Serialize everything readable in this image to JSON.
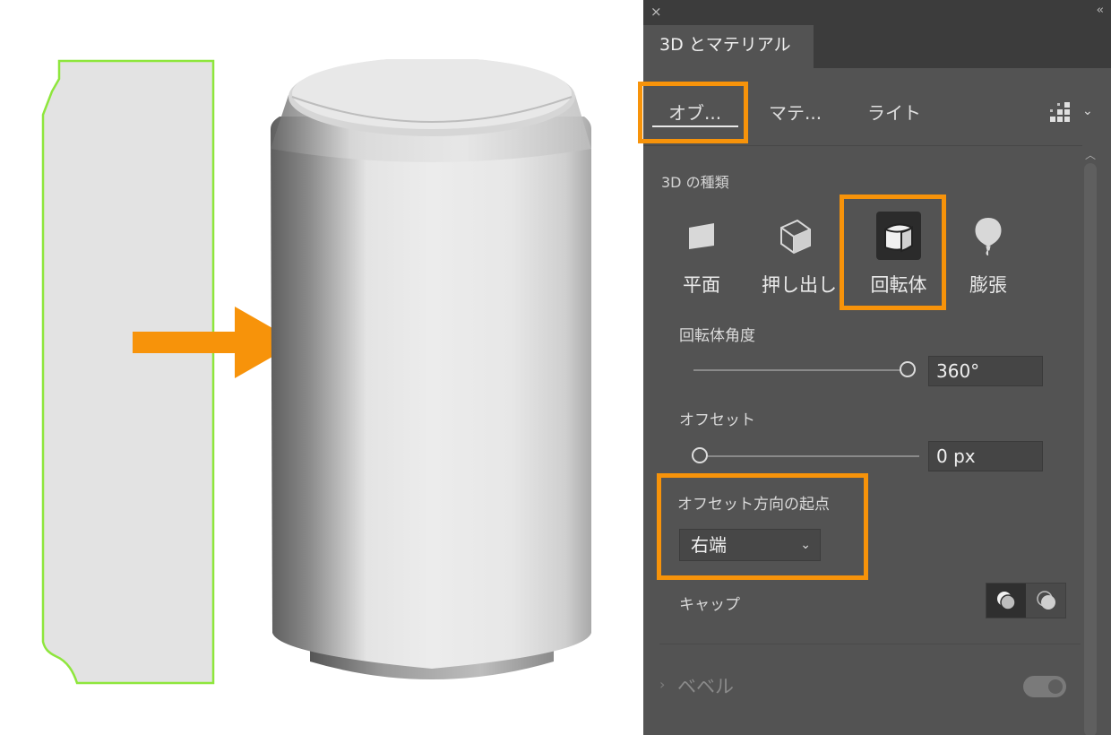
{
  "panel": {
    "title": "3D とマテリアル",
    "close_glyph": "×",
    "collapse_glyph": "‹‹",
    "subtabs": {
      "object": "オブ...",
      "material": "マテ...",
      "light": "ライト"
    },
    "preset_icon": "preset-grid-icon",
    "type_section_label": "3D の種類",
    "types": {
      "plane": "平面",
      "extrude": "押し出し",
      "revolve": "回転体",
      "inflate": "膨張"
    },
    "selected_type": "回転体",
    "revolve_angle": {
      "label": "回転体角度",
      "value": "360°",
      "slider_fraction": 1.0
    },
    "offset": {
      "label": "オフセット",
      "value": "0 px",
      "slider_fraction": 0.0
    },
    "offset_origin": {
      "label": "オフセット方向の起点",
      "value": "右端"
    },
    "cap": {
      "label": "キャップ",
      "selected": "cap-on"
    },
    "bevel": {
      "label": "ベベル",
      "enabled": false
    }
  },
  "colors": {
    "highlight": "#f7930a",
    "profile_outline": "#8ee63c",
    "panel_bg": "#535353"
  }
}
